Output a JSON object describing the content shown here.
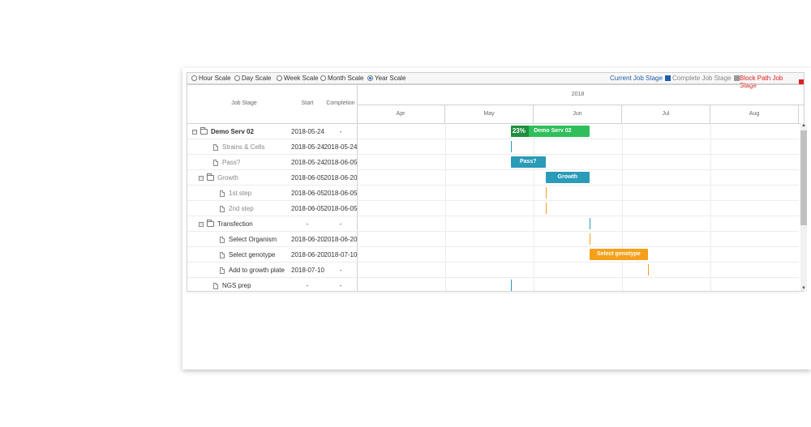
{
  "toolbar": {
    "scales": [
      {
        "label": "Hour Scale",
        "selected": false
      },
      {
        "label": "Day Scale",
        "selected": false
      },
      {
        "label": "Week Scale",
        "selected": false
      },
      {
        "label": "Month Scale",
        "selected": false
      },
      {
        "label": "Year Scale",
        "selected": true
      }
    ],
    "legend": [
      {
        "label": "Current Job Stage",
        "color": "#1f5fa8",
        "text_color": "#1f5fa8"
      },
      {
        "label": "Complete Job Stage",
        "color": "#999999",
        "text_color": "#888888"
      },
      {
        "label": "Block Path Job Stage",
        "color": "#e02020",
        "text_color": "#e02020"
      }
    ]
  },
  "columns": {
    "job_stage": "Job Stage",
    "start": "Start",
    "completion": "Completion"
  },
  "timeline": {
    "year": "2018",
    "months": [
      "Apr",
      "May",
      "Jun",
      "Jul",
      "Aug"
    ]
  },
  "rows": [
    {
      "name": "Demo Serv 02",
      "start": "2018-05-24",
      "completion": "-",
      "level": 0,
      "type": "folder",
      "bold": true,
      "color": "#333333"
    },
    {
      "name": "Strains & Cells",
      "start": "2018-05-24",
      "completion": "2018-05-24",
      "level": 1,
      "type": "file",
      "bold": false,
      "color": "#888888"
    },
    {
      "name": "Pass?",
      "start": "2018-05-24",
      "completion": "2018-06-05",
      "level": 1,
      "type": "file",
      "bold": false,
      "color": "#888888"
    },
    {
      "name": "Growth",
      "start": "2018-06-05",
      "completion": "2018-06-20",
      "level": 1,
      "type": "folder",
      "bold": false,
      "color": "#888888"
    },
    {
      "name": "1st step",
      "start": "2018-06-05",
      "completion": "2018-06-05",
      "level": 2,
      "type": "file",
      "bold": false,
      "color": "#888888"
    },
    {
      "name": "2nd step",
      "start": "2018-06-05",
      "completion": "2018-06-05",
      "level": 2,
      "type": "file",
      "bold": false,
      "color": "#888888"
    },
    {
      "name": "Transfection",
      "start": "-",
      "completion": "-",
      "level": 1,
      "type": "folder",
      "bold": false,
      "color": "#333333"
    },
    {
      "name": "Select Organism",
      "start": "2018-06-20",
      "completion": "2018-06-20",
      "level": 2,
      "type": "file",
      "bold": false,
      "color": "#333333"
    },
    {
      "name": "Select genotype",
      "start": "2018-06-20",
      "completion": "2018-07-10",
      "level": 2,
      "type": "file",
      "bold": false,
      "color": "#333333"
    },
    {
      "name": "Add to growth plate",
      "start": "2018-07-10",
      "completion": "-",
      "level": 2,
      "type": "file",
      "bold": false,
      "color": "#333333"
    },
    {
      "name": "NGS prep",
      "start": "-",
      "completion": "-",
      "level": 1,
      "type": "file",
      "bold": false,
      "color": "#333333"
    }
  ],
  "bars": [
    {
      "row": 0,
      "start": "2018-05-24",
      "end": "2018-06-20",
      "label": "Demo Serv 02",
      "progress_label": "23%",
      "progress": 0.23,
      "color": "#2fbf5a",
      "progress_color": "#1e8f3e"
    },
    {
      "row": 2,
      "start": "2018-05-24",
      "end": "2018-06-05",
      "label": "Pass?",
      "color": "#2a9bb8"
    },
    {
      "row": 3,
      "start": "2018-06-05",
      "end": "2018-06-20",
      "label": "Growth",
      "color": "#2a9bb8"
    },
    {
      "row": 8,
      "start": "2018-06-20",
      "end": "2018-07-10",
      "label": "Select genotype",
      "color": "#f5a01a"
    }
  ],
  "markers": [
    {
      "row": 1,
      "date": "2018-05-24",
      "color": "#2a9bb8"
    },
    {
      "row": 4,
      "date": "2018-06-05",
      "color": "#f5a01a"
    },
    {
      "row": 5,
      "date": "2018-06-05",
      "color": "#f5a01a"
    },
    {
      "row": 6,
      "date": "2018-06-20",
      "color": "#2a9bb8"
    },
    {
      "row": 7,
      "date": "2018-06-20",
      "color": "#f5a01a"
    },
    {
      "row": 9,
      "date": "2018-07-10",
      "color": "#f5a01a"
    },
    {
      "row": 10,
      "date": "2018-05-24",
      "color": "#2a9bb8"
    }
  ]
}
